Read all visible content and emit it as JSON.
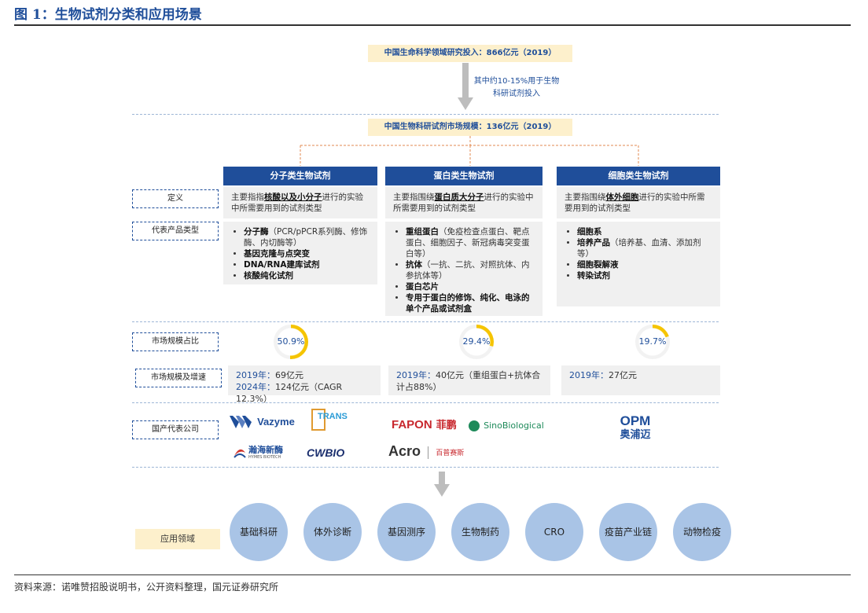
{
  "title": "图 1：生物试剂分类和应用场景",
  "top_box": "中国生命科学领域研究投入：866亿元（2019）",
  "arrow_note_1": "其中约10-15%用于生物",
  "arrow_note_2": "科研试剂投入",
  "market_box": "中国生物科研试剂市场规模：136亿元（2019）",
  "row_labels": {
    "definition": "定义",
    "products": "代表产品类型",
    "share": "市场规模占比",
    "size": "市场规模及增速",
    "companies": "国产代表公司",
    "applications": "应用领域"
  },
  "columns": [
    {
      "header": "分子类生物试剂",
      "def_pre": "主要指指",
      "def_key": "核酸以及小分子",
      "def_post": "进行的实验中所需要用到的试剂类型",
      "products": [
        {
          "bold": "分子酶",
          "rest": "（PCR/pPCR系列酶、修饰酶、内切酶等）"
        },
        {
          "bold": "基因克隆与点突变",
          "rest": ""
        },
        {
          "bold": "DNA/RNA建库试剂",
          "rest": ""
        },
        {
          "bold": "核酸纯化试剂",
          "rest": ""
        }
      ],
      "share": "50.9%",
      "share_value": 50.9,
      "size_lines": [
        {
          "year": "2019年：",
          "text": "69亿元"
        },
        {
          "year": "2024年：",
          "text": "124亿元（CAGR 12.3%）"
        }
      ]
    },
    {
      "header": "蛋白类生物试剂",
      "def_pre": "主要指围绕",
      "def_key": "蛋白质大分子",
      "def_post": "进行的实验中所需要用到的试剂类型",
      "products": [
        {
          "bold": "重组蛋白",
          "rest": "（免疫检查点蛋白、靶点蛋白、细胞因子、新冠病毒突变蛋白等）"
        },
        {
          "bold": "抗体",
          "rest": "（一抗、二抗、对照抗体、内参抗体等）"
        },
        {
          "bold": "蛋白芯片",
          "rest": ""
        },
        {
          "bold": "专用于蛋白的修饰、纯化、电泳的单个产品或试剂盒",
          "rest": ""
        }
      ],
      "share": "29.4%",
      "share_value": 29.4,
      "size_lines": [
        {
          "year": "2019年：",
          "text": "40亿元（重组蛋白+抗体合计占88%）"
        }
      ]
    },
    {
      "header": "细胞类生物试剂",
      "def_pre": "主要指围绕",
      "def_key": "体外细胞",
      "def_post": "进行的实验中所需要用到的试剂类型",
      "products": [
        {
          "bold": "细胞系",
          "rest": ""
        },
        {
          "bold": "培养产品",
          "rest": "（培养基、血清、添加剂等）"
        },
        {
          "bold": "细胞裂解液",
          "rest": ""
        },
        {
          "bold": "转染试剂",
          "rest": ""
        }
      ],
      "share": "19.7%",
      "share_value": 19.7,
      "size_lines": [
        {
          "year": "2019年：",
          "text": "27亿元"
        }
      ]
    }
  ],
  "companies": {
    "vazyme": "Vazyme",
    "trans": "TRANS",
    "hymes": "瀚海新酶",
    "hymes_sub": "HYMES BIOTECH",
    "cwbio": "CWBIO",
    "fapon": "FAPON",
    "fapon_cn": "菲鹏",
    "sino": "SinoBiological",
    "acro": "Acro",
    "acro_sub": "百普赛斯",
    "opm": "OPM",
    "opm_cn": "奥浦迈"
  },
  "applications": [
    "基础科研",
    "体外诊断",
    "基因测序",
    "生物制药",
    "CRO",
    "疫苗产业链",
    "动物检疫"
  ],
  "source": "资料来源：诺唯赞招股说明书，公开资料整理，国元证券研究所",
  "colors": {
    "blue": "#1f4e9a",
    "yellow": "#f5c400",
    "yellow_bg": "#fdf0cc",
    "circle": "#a9c4e6",
    "gray": "#f0f0f0"
  }
}
